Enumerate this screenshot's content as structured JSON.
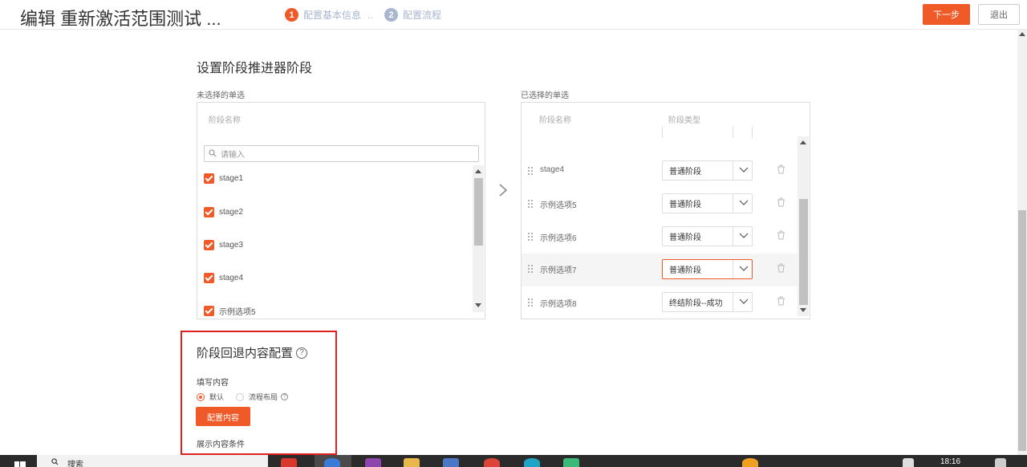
{
  "header": {
    "title": "编辑 重新激活范围测试 ...",
    "steps": [
      {
        "num": "1",
        "label": "配置基本信息"
      },
      {
        "num": "2",
        "label": "配置流程"
      }
    ],
    "separator": "..",
    "next_label": "下一步",
    "exit_label": "退出",
    "accent_color": "#f05a28"
  },
  "stage_section": {
    "title": "设置阶段推进器阶段",
    "unselected": {
      "label": "未选择的单选",
      "column": "阶段名称",
      "search_placeholder": "请输入",
      "items": [
        "stage1",
        "stage2",
        "stage3",
        "stage4",
        "示例选项5"
      ]
    },
    "selected": {
      "label": "已选择的单选",
      "col_name": "阶段名称",
      "col_type": "阶段类型",
      "rows": [
        {
          "name": "stage4",
          "type": "普通阶段"
        },
        {
          "name": "示例选项5",
          "type": "普通阶段"
        },
        {
          "name": "示例选项6",
          "type": "普通阶段"
        },
        {
          "name": "示例选项7",
          "type": "普通阶段"
        },
        {
          "name": "示例选项8",
          "type": "终结阶段--成功"
        }
      ]
    }
  },
  "rollback": {
    "title": "阶段回退内容配置",
    "help": "?",
    "fill_label": "填写内容",
    "options": [
      "默认",
      "流程布局"
    ],
    "selected_option": "默认",
    "config_button": "配置内容",
    "display_label": "展示内容条件"
  },
  "taskbar": {
    "search_text": "搜索",
    "clock": "18:16"
  }
}
